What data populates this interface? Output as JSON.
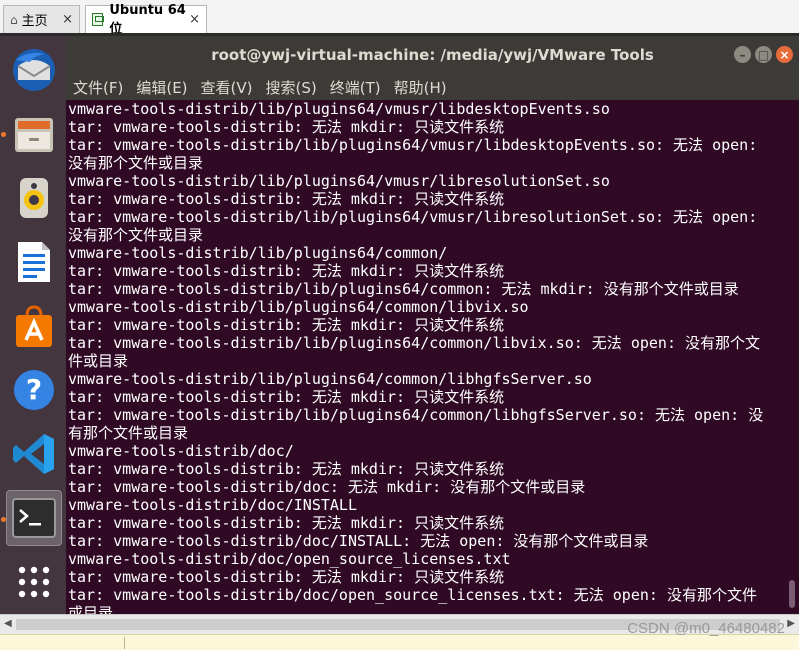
{
  "host": {
    "tabs": [
      {
        "label": "主页"
      },
      {
        "label": "Ubuntu 64 位"
      }
    ]
  },
  "window": {
    "title": "root@ywj-virtual-machine: /media/ywj/VMware Tools"
  },
  "menu": [
    "文件(F)",
    "编辑(E)",
    "查看(V)",
    "搜索(S)",
    "终端(T)",
    "帮助(H)"
  ],
  "terminal": {
    "lines": [
      "vmware-tools-distrib/lib/plugins64/vmusr/libdesktopEvents.so",
      "tar: vmware-tools-distrib: 无法 mkdir: 只读文件系统",
      "tar: vmware-tools-distrib/lib/plugins64/vmusr/libdesktopEvents.so: 无法 open:",
      "没有那个文件或目录",
      "vmware-tools-distrib/lib/plugins64/vmusr/libresolutionSet.so",
      "tar: vmware-tools-distrib: 无法 mkdir: 只读文件系统",
      "tar: vmware-tools-distrib/lib/plugins64/vmusr/libresolutionSet.so: 无法 open:",
      "没有那个文件或目录",
      "vmware-tools-distrib/lib/plugins64/common/",
      "tar: vmware-tools-distrib: 无法 mkdir: 只读文件系统",
      "tar: vmware-tools-distrib/lib/plugins64/common: 无法 mkdir: 没有那个文件或目录",
      "vmware-tools-distrib/lib/plugins64/common/libvix.so",
      "tar: vmware-tools-distrib: 无法 mkdir: 只读文件系统",
      "tar: vmware-tools-distrib/lib/plugins64/common/libvix.so: 无法 open: 没有那个文",
      "件或目录",
      "vmware-tools-distrib/lib/plugins64/common/libhgfsServer.so",
      "tar: vmware-tools-distrib: 无法 mkdir: 只读文件系统",
      "tar: vmware-tools-distrib/lib/plugins64/common/libhgfsServer.so: 无法 open: 没",
      "有那个文件或目录",
      "vmware-tools-distrib/doc/",
      "tar: vmware-tools-distrib: 无法 mkdir: 只读文件系统",
      "tar: vmware-tools-distrib/doc: 无法 mkdir: 没有那个文件或目录",
      "vmware-tools-distrib/doc/INSTALL",
      "tar: vmware-tools-distrib: 无法 mkdir: 只读文件系统",
      "tar: vmware-tools-distrib/doc/INSTALL: 无法 open: 没有那个文件或目录",
      "vmware-tools-distrib/doc/open_source_licenses.txt",
      "tar: vmware-tools-distrib: 无法 mkdir: 只读文件系统",
      "tar: vmware-tools-distrib/doc/open_source_licenses.txt: 无法 open: 没有那个文件",
      "或目录"
    ]
  },
  "watermark": "CSDN @m0_46480482",
  "colors": {
    "terminal_bg": "#300a24",
    "launcher_bg": "#43363f",
    "titlebar_bg": "#3c3b37",
    "close_button": "#e86b3a"
  },
  "launcher_icons": [
    "thunderbird-mail-icon",
    "files-cabinet-icon",
    "rhythmbox-speaker-icon",
    "libreoffice-writer-icon",
    "ubuntu-software-bag-icon",
    "help-question-icon",
    "vscode-icon",
    "terminal-icon",
    "show-applications-grid-icon"
  ]
}
